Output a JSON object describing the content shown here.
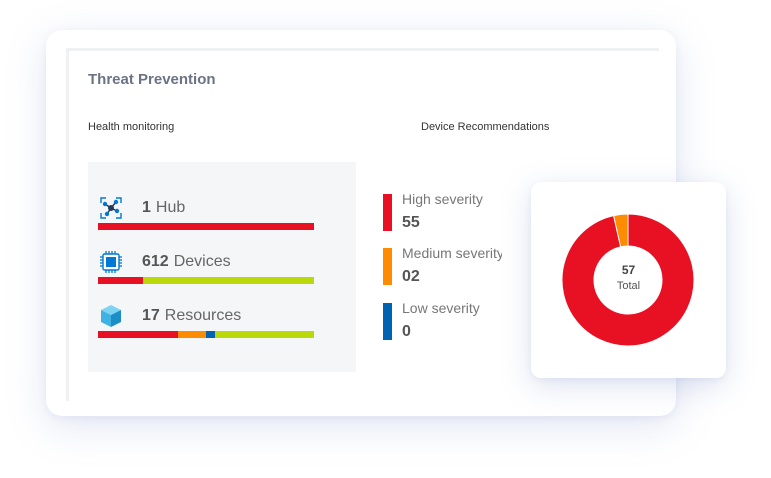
{
  "card": {
    "title": "Threat Prevention",
    "health_label": "Health monitoring",
    "recommend_label": "Device Recommendations"
  },
  "health": [
    {
      "count": "1",
      "label": "Hub",
      "icon": "network-hub-icon",
      "bar": [
        {
          "color": "#e81123",
          "fraction": 1.0
        }
      ]
    },
    {
      "count": "612",
      "label": "Devices",
      "icon": "chip-icon",
      "bar": [
        {
          "color": "#e81123",
          "fraction": 0.21
        },
        {
          "color": "#bad80a",
          "fraction": 0.79
        }
      ]
    },
    {
      "count": "17",
      "label": "Resources",
      "icon": "cube-icon",
      "bar": [
        {
          "color": "#e81123",
          "fraction": 0.37
        },
        {
          "color": "#ff8c00",
          "fraction": 0.13
        },
        {
          "color": "#0063b1",
          "fraction": 0.04
        },
        {
          "color": "#bad80a",
          "fraction": 0.46
        }
      ]
    }
  ],
  "recommendations": [
    {
      "name": "High severity",
      "value": "55",
      "color": "#e81123"
    },
    {
      "name": "Medium severity",
      "value": "02",
      "color": "#ff8c00"
    },
    {
      "name": "Low severity",
      "value": "0",
      "color": "#0063b1"
    }
  ],
  "donut": {
    "total": "57",
    "total_label": "Total"
  },
  "colors": {
    "high": "#e81123",
    "medium": "#ff8c00",
    "low": "#0063b1",
    "ok": "#bad80a"
  }
}
